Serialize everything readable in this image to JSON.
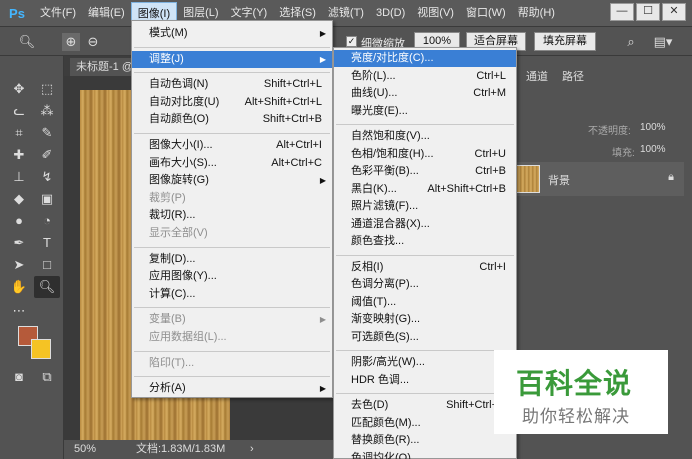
{
  "app": {
    "logo": "Ps"
  },
  "menubar": {
    "items": [
      "文件(F)",
      "编辑(E)",
      "图像(I)",
      "图层(L)",
      "文字(Y)",
      "选择(S)",
      "滤镜(T)",
      "3D(D)",
      "视图(V)",
      "窗口(W)",
      "帮助(H)"
    ],
    "active_index": 2
  },
  "window_controls": {
    "minimize": "—",
    "restore": "☐",
    "close": "✕"
  },
  "options_bar": {
    "zoom_label": "细微缩放",
    "zoom_percent": "100%",
    "fit_screen": "适合屏幕",
    "fill_screen": "填充屏幕"
  },
  "document": {
    "tab_title": "未标题-1 @",
    "zoom": "50%",
    "doc_info": "文档:1.83M/1.83M"
  },
  "right_panel": {
    "tabs": [
      "通道",
      "路径"
    ],
    "opacity_label": "不透明度:",
    "opacity_value": "100%",
    "fill_label": "填充:",
    "fill_value": "100%",
    "layer_name": "背景"
  },
  "image_menu": {
    "items": [
      {
        "label": "模式(M)",
        "shortcut": "",
        "submenu": true,
        "disabled": false
      },
      {
        "sep": true
      },
      {
        "label": "调整(J)",
        "shortcut": "",
        "submenu": true,
        "disabled": false,
        "highlight": true
      },
      {
        "sep": true
      },
      {
        "label": "自动色调(N)",
        "shortcut": "Shift+Ctrl+L",
        "disabled": false
      },
      {
        "label": "自动对比度(U)",
        "shortcut": "Alt+Shift+Ctrl+L",
        "disabled": false
      },
      {
        "label": "自动颜色(O)",
        "shortcut": "Shift+Ctrl+B",
        "disabled": false
      },
      {
        "sep": true
      },
      {
        "label": "图像大小(I)...",
        "shortcut": "Alt+Ctrl+I",
        "disabled": false
      },
      {
        "label": "画布大小(S)...",
        "shortcut": "Alt+Ctrl+C",
        "disabled": false
      },
      {
        "label": "图像旋转(G)",
        "shortcut": "",
        "submenu": true,
        "disabled": false
      },
      {
        "label": "裁剪(P)",
        "shortcut": "",
        "disabled": true
      },
      {
        "label": "裁切(R)...",
        "shortcut": "",
        "disabled": false
      },
      {
        "label": "显示全部(V)",
        "shortcut": "",
        "disabled": true
      },
      {
        "sep": true
      },
      {
        "label": "复制(D)...",
        "shortcut": "",
        "disabled": false
      },
      {
        "label": "应用图像(Y)...",
        "shortcut": "",
        "disabled": false
      },
      {
        "label": "计算(C)...",
        "shortcut": "",
        "disabled": false
      },
      {
        "sep": true
      },
      {
        "label": "变量(B)",
        "shortcut": "",
        "submenu": true,
        "disabled": true
      },
      {
        "label": "应用数据组(L)...",
        "shortcut": "",
        "disabled": true
      },
      {
        "sep": true
      },
      {
        "label": "陷印(T)...",
        "shortcut": "",
        "disabled": true
      },
      {
        "sep": true
      },
      {
        "label": "分析(A)",
        "shortcut": "",
        "submenu": true,
        "disabled": false
      }
    ]
  },
  "adjust_menu": {
    "items": [
      {
        "label": "亮度/对比度(C)...",
        "shortcut": "",
        "highlight": true
      },
      {
        "label": "色阶(L)...",
        "shortcut": "Ctrl+L"
      },
      {
        "label": "曲线(U)...",
        "shortcut": "Ctrl+M"
      },
      {
        "label": "曝光度(E)...",
        "shortcut": ""
      },
      {
        "sep": true
      },
      {
        "label": "自然饱和度(V)...",
        "shortcut": ""
      },
      {
        "label": "色相/饱和度(H)...",
        "shortcut": "Ctrl+U"
      },
      {
        "label": "色彩平衡(B)...",
        "shortcut": "Ctrl+B"
      },
      {
        "label": "黑白(K)...",
        "shortcut": "Alt+Shift+Ctrl+B"
      },
      {
        "label": "照片滤镜(F)...",
        "shortcut": ""
      },
      {
        "label": "通道混合器(X)...",
        "shortcut": ""
      },
      {
        "label": "颜色查找...",
        "shortcut": ""
      },
      {
        "sep": true
      },
      {
        "label": "反相(I)",
        "shortcut": "Ctrl+I"
      },
      {
        "label": "色调分离(P)...",
        "shortcut": ""
      },
      {
        "label": "阈值(T)...",
        "shortcut": ""
      },
      {
        "label": "渐变映射(G)...",
        "shortcut": ""
      },
      {
        "label": "可选颜色(S)...",
        "shortcut": ""
      },
      {
        "sep": true
      },
      {
        "label": "阴影/高光(W)...",
        "shortcut": ""
      },
      {
        "label": "HDR 色调...",
        "shortcut": ""
      },
      {
        "sep": true
      },
      {
        "label": "去色(D)",
        "shortcut": "Shift+Ctrl+U"
      },
      {
        "label": "匹配颜色(M)...",
        "shortcut": ""
      },
      {
        "label": "替换颜色(R)...",
        "shortcut": ""
      },
      {
        "label": "色调均化(Q)",
        "shortcut": ""
      }
    ]
  },
  "watermark": {
    "title": "百科全说",
    "subtitle": "助你轻松解决"
  }
}
